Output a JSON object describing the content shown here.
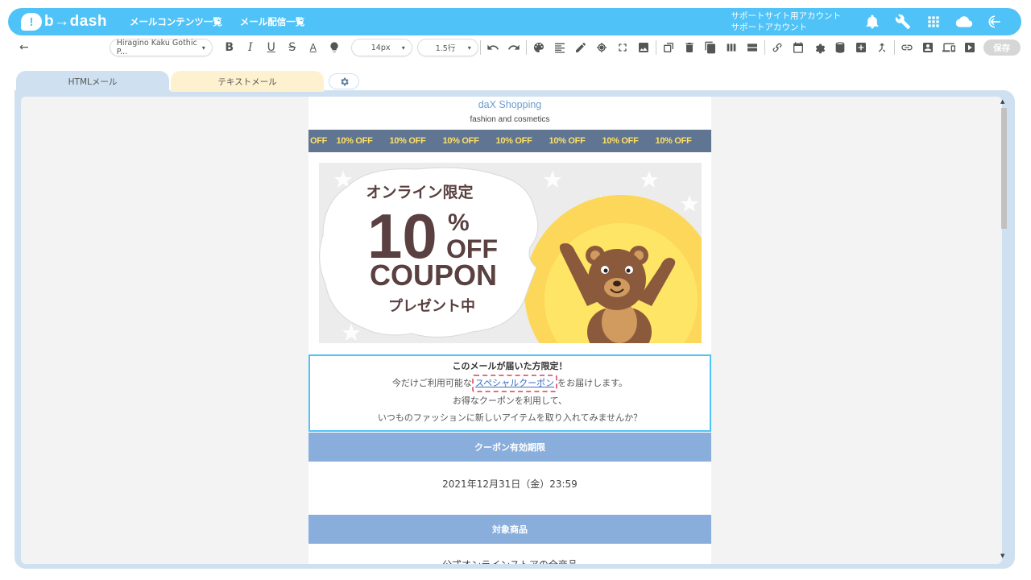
{
  "app": {
    "logo_mark": "!",
    "logo_text": "b→dash",
    "nav": [
      "メールコンテンツ一覧",
      "メール配信一覧"
    ],
    "account_line1": "サポートサイト用アカウント",
    "account_line2": "サポートアカウント"
  },
  "toolbar": {
    "back": "←",
    "font_family": "Hiragino Kaku Gothic P...",
    "font_size": "14px",
    "line_height": "1.5行",
    "bold": "B",
    "italic": "I",
    "underline": "U",
    "strike": "S",
    "font_color": "A",
    "chevron": "▾",
    "save_label": "保存"
  },
  "editor": {
    "tab_html": "HTMLメール",
    "tab_text": "テキストメール"
  },
  "email": {
    "shop_name": "daX Shopping",
    "shop_sub": "fashion and cosmetics",
    "strip_items": [
      "OFF",
      "10% OFF",
      "10% OFF",
      "10% OFF",
      "10% OFF",
      "10% OFF",
      "10% OFF",
      "10% OFF"
    ],
    "banner": {
      "line1": "オンライン限定",
      "big_number": "10",
      "percent": "%",
      "off": "OFF",
      "coupon": "COUPON",
      "line4": "プレゼント中"
    },
    "body": {
      "headline": "このメールが届いた方限定！",
      "line2_pre": "今だけご利用可能な",
      "line2_link": "スペシャルクーポン",
      "line2_post": "をお届けします。",
      "line3": "お得なクーポンを利用して、",
      "line4": "いつものファッションに新しいアイテムを取り入れてみませんか？"
    },
    "section1_title": "クーポン有効期限",
    "expiry": "2021年12月31日（金）23:59",
    "section2_title": "対象商品",
    "products": "公式オンラインストアの全商品"
  },
  "colors": {
    "header": "#4fc3f7",
    "section": "#8aaedc",
    "strip": "#5f7591",
    "highlight": "#e56e7d"
  }
}
